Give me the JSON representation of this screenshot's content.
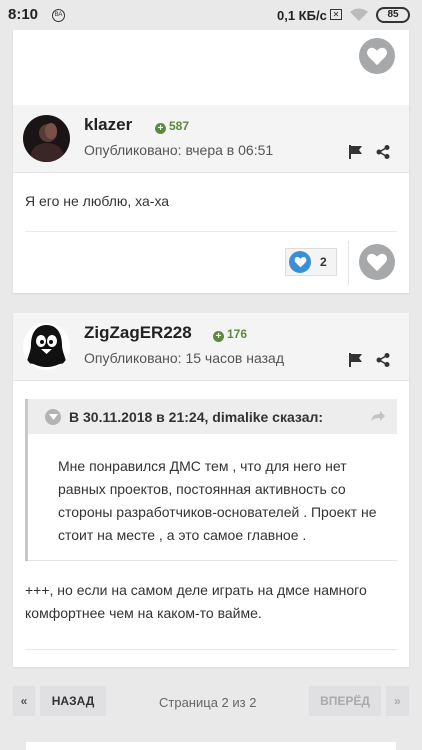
{
  "status_bar": {
    "time": "8:10",
    "notification_badge": "ВА",
    "speed": "0,1 КБ/с",
    "battery": "85"
  },
  "posts": [
    {
      "username": "klazer",
      "reputation": "587",
      "published": "Опубликовано: вчера в 06:51",
      "text": "Я его не люблю, ха-ха",
      "reactions": {
        "count": "2"
      }
    },
    {
      "username": "ZigZagER228",
      "reputation": "176",
      "published": "Опубликовано: 15 часов назад",
      "quote": {
        "title": "В 30.11.2018 в 21:24, dimalike сказал:",
        "text": "Мне понравился ДМС тем , что для него нет равных проектов, постоянная активность со стороны разработчиков-основателей . Проект не стоит на месте , а это самое главное ."
      },
      "text": "+++, но если на самом деле играть на дмсе намного комфортнее чем на каком-то вайме."
    }
  ],
  "pagination": {
    "first": "«",
    "prev": "НАЗАД",
    "page_label": "Страница 2 из 2",
    "next": "ВПЕРЁД",
    "last": "»"
  },
  "colors": {
    "background": "#e9e9ea",
    "reputation_green": "#5b8a3c",
    "reaction_blue": "#3b8fd6",
    "heart_grey": "#a7a8aa"
  }
}
